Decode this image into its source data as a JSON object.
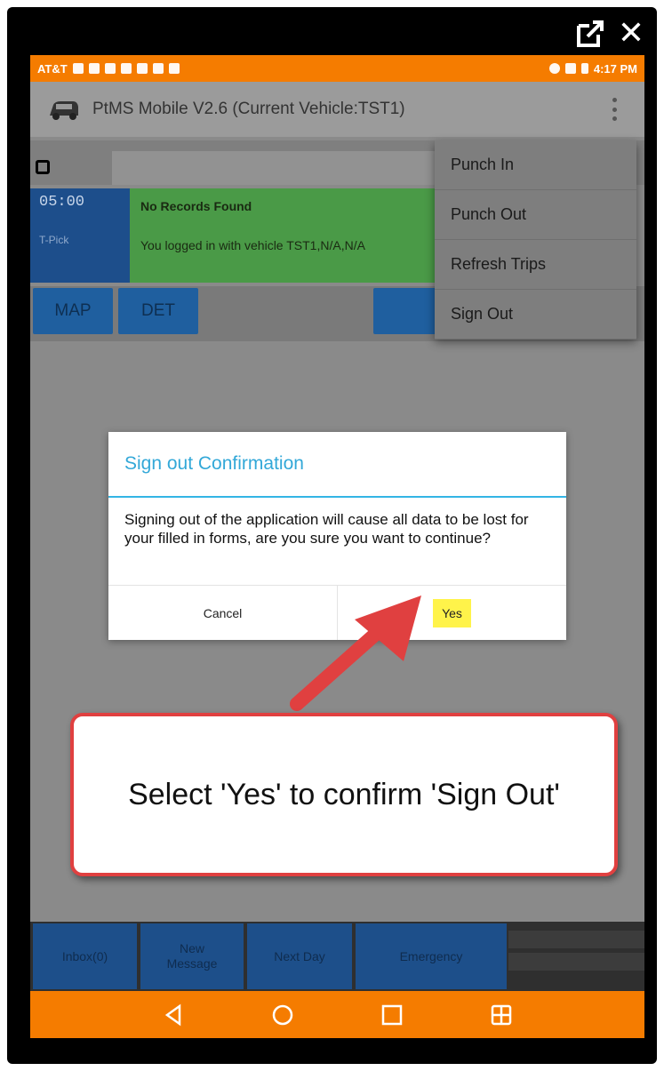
{
  "window": {
    "external_icon": "external-link-icon",
    "close_icon": "close-icon"
  },
  "statusbar": {
    "carrier": "AT&T",
    "time": "4:17 PM",
    "colors": {
      "bar": "#f57c00"
    }
  },
  "appbar": {
    "title": "PtMS Mobile V2.6  (Current Vehicle:TST1)"
  },
  "trip": {
    "time": "05:00",
    "type": "T-Pick",
    "title": "No Records Found",
    "message": "You logged in with vehicle TST1,N/A,N/A"
  },
  "actions": {
    "map": "MAP",
    "det": "DET"
  },
  "menu": {
    "items": [
      "Punch In",
      "Punch Out",
      "Refresh Trips",
      "Sign Out"
    ]
  },
  "dialog": {
    "title": "Sign out Confirmation",
    "body": " Signing out of the application will cause all data to be lost for your filled in forms, are you sure you want to continue?",
    "cancel": "Cancel",
    "yes": "Yes"
  },
  "callout": {
    "text": "Select 'Yes' to confirm 'Sign Out'"
  },
  "bottom": {
    "inbox": "Inbox(0)",
    "new_message_line1": "New",
    "new_message_line2": "Message",
    "next_day": "Next Day",
    "emergency": "Emergency"
  }
}
